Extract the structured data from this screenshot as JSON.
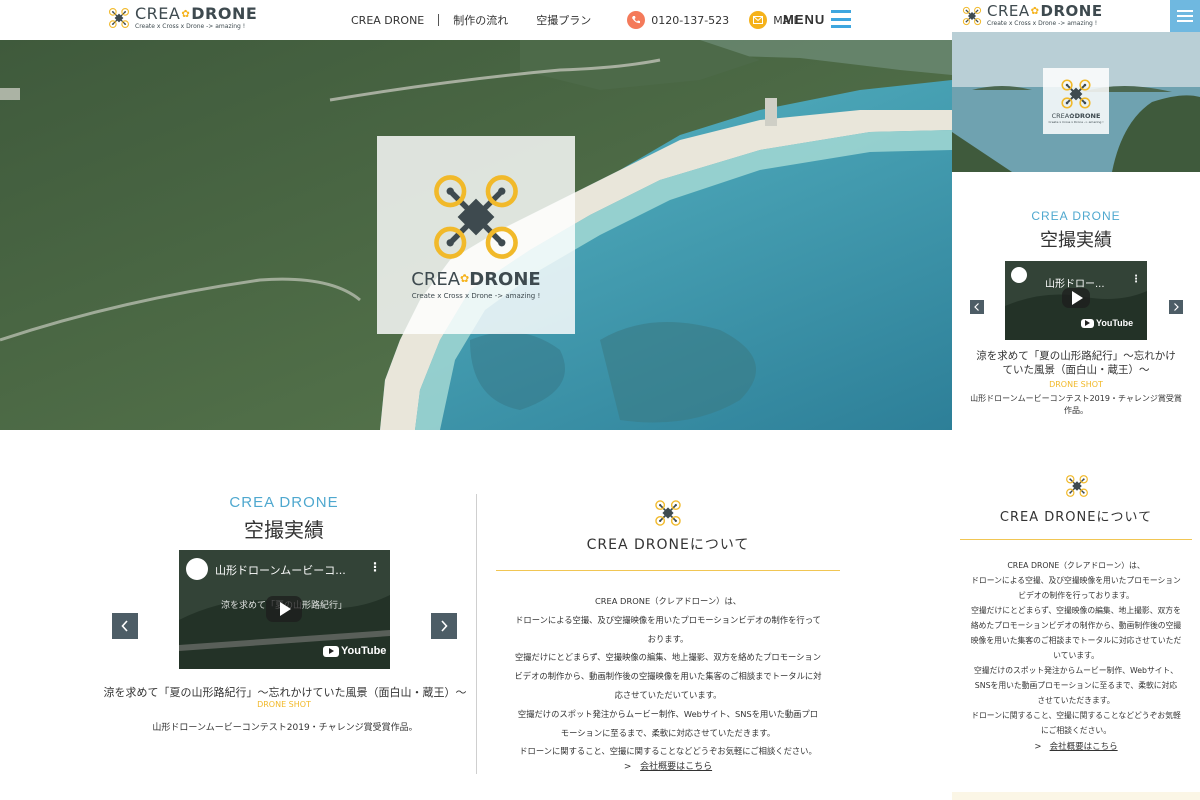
{
  "brand": {
    "name_part1": "CREA",
    "name_part2": "DRONE",
    "tagline": "Create x Cross x Drone -> amazing !"
  },
  "nav": {
    "items": [
      "CREA DRONE",
      "制作の流れ",
      "空撮プラン"
    ],
    "phone": "0120-137-523",
    "mail": "MAIL",
    "menu": "MENU"
  },
  "works": {
    "title_en": "CREA DRONE",
    "title_ja": "空撮実績",
    "video_title": "山形ドローンムービーコ...",
    "mobile_video_title": "山形ドロー...",
    "video_overlay_text": "涼を求めて「夏の山形路紀行」",
    "youtube_label": "YouTube",
    "prev_icon": "chevron-left-icon",
    "next_icon": "chevron-right-icon",
    "caption": "涼を求めて「夏の山形路紀行」～忘れかけていた風景（面白山・蔵王）～",
    "mobile_caption_line1": "涼を求めて「夏の山形路紀行」～忘れかけ",
    "mobile_caption_line2": "ていた風景（面白山・蔵王）～",
    "category": "DRONE SHOT",
    "description": "山形ドローンムービーコンテスト2019・チャレンジ賞受賞作品。",
    "mobile_description_line1": "山形ドローンムービーコンテスト2019・チャレンジ賞受賞",
    "mobile_description_line2": "作品。"
  },
  "about": {
    "title": "CREA DRONEについて",
    "lines": [
      "CREA DRONE（クレアドローン）は、",
      "ドローンによる空撮、及び空撮映像を用いたプロモーションビデオの制作を行って",
      "おります。",
      "空撮だけにとどまらず、空撮映像の編集、地上撮影、双方を絡めたプロモーション",
      "ビデオの制作から、動画制作後の空撮映像を用いた集客のご相談までトータルに対",
      "応させていただいています。",
      "空撮だけのスポット発注からムービー制作、Webサイト、SNSを用いた動画プロ",
      "モーションに至るまで、柔軟に対応させていただきます。",
      "ドローンに関すること、空撮に関することなどどうぞお気軽にご相談ください。"
    ],
    "mobile_lines": [
      "CREA DRONE（クレアドローン）は、",
      "ドローンによる空撮、及び空撮映像を用いたプロモーション",
      "ビデオの制作を行っております。",
      "空撮だけにとどまらず、空撮映像の編集、地上撮影、双方を",
      "絡めたプロモーションビデオの制作から、動画制作後の空撮",
      "映像を用いた集客のご相談までトータルに対応させていただ",
      "いています。",
      "空撮だけのスポット発注からムービー制作、Webサイト、",
      "SNSを用いた動画プロモーションに至るまで、柔軟に対応",
      "させていただきます。",
      "ドローンに関すること、空撮に関することなどどうぞお気軽",
      "にご相談ください。"
    ],
    "link_prefix": ">",
    "link": "会社概要はこちら"
  },
  "colors": {
    "accent_blue": "#4fa8cf",
    "gold": "#f1b92a",
    "brand_dark": "#3e4a4f",
    "phone_icon_bg": "#f47a5a",
    "mail_icon_bg": "#f5b21b"
  },
  "icons": {
    "logo": "drone-logo-icon",
    "phone": "phone-icon",
    "mail": "mail-icon",
    "menu": "hamburger-menu-icon"
  }
}
